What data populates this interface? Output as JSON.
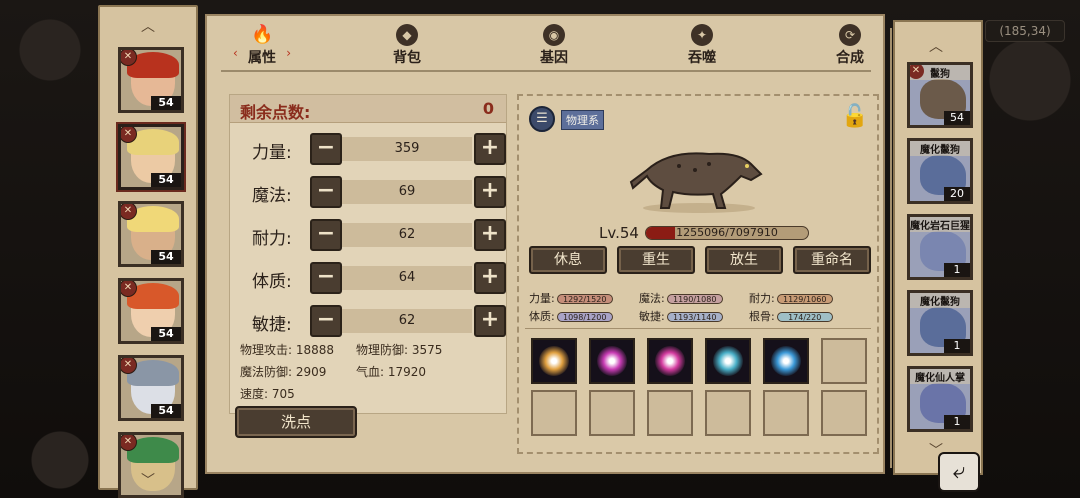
{
  "coord_text": "(185,34)",
  "roster": [
    {
      "level": "54",
      "hair": "#b8321e",
      "skin": "#e6b896"
    },
    {
      "level": "54",
      "hair": "#e8d27a",
      "skin": "#eccaa4"
    },
    {
      "level": "54",
      "hair": "#f0d878",
      "skin": "#d9b08a"
    },
    {
      "level": "54",
      "hair": "#d8582a",
      "skin": "#efcfae"
    },
    {
      "level": "54",
      "hair": "#8a96a6",
      "skin": "#dcdfe6"
    },
    {
      "level": "",
      "hair": "#3e8a4a",
      "skin": "#d8c08a"
    }
  ],
  "tabs": [
    {
      "label": "属性"
    },
    {
      "label": "背包"
    },
    {
      "label": "基因"
    },
    {
      "label": "吞噬"
    },
    {
      "label": "合成"
    }
  ],
  "stats": {
    "remaining_label": "剩余点数:",
    "remaining_value": "0",
    "rows": [
      {
        "name": "力量:",
        "value": "359"
      },
      {
        "name": "魔法:",
        "value": "69"
      },
      {
        "name": "耐力:",
        "value": "62"
      },
      {
        "name": "体质:",
        "value": "64"
      },
      {
        "name": "敏捷:",
        "value": "62"
      }
    ],
    "minus": "−",
    "plus": "+",
    "derived": {
      "phys_atk": "物理攻击: 18888",
      "phys_def": "物理防御: 3575",
      "mag_def": "魔法防御: 2909",
      "hp": "气血: 17920",
      "speed": "速度: 705"
    },
    "reset_label": "洗点"
  },
  "creature": {
    "category": "物理系",
    "level": "Lv.54",
    "hp_text": "1255096/7097910",
    "hp_fraction": 0.18,
    "actions": [
      "休息",
      "重生",
      "放生",
      "重命名"
    ],
    "stats": [
      {
        "label": "力量:",
        "value": "1292/1520",
        "color": "#c58e7a"
      },
      {
        "label": "魔法:",
        "value": "1190/1080",
        "color": "#c5a0a0"
      },
      {
        "label": "耐力:",
        "value": "1129/1060",
        "color": "#c99c76"
      },
      {
        "label": "体质:",
        "value": "1098/1200",
        "color": "#a9a3c6"
      },
      {
        "label": "敏捷:",
        "value": "1193/1140",
        "color": "#a6b0c8"
      },
      {
        "label": "根骨:",
        "value": "174/220",
        "color": "#9fbfc6"
      }
    ],
    "skills": [
      {
        "color": "#e0a040"
      },
      {
        "color": "#c83cb4"
      },
      {
        "color": "#d43ca0"
      },
      {
        "color": "#4ab0c8"
      },
      {
        "color": "#3c9ad8"
      },
      {
        "color": ""
      },
      {
        "color": ""
      },
      {
        "color": ""
      },
      {
        "color": ""
      },
      {
        "color": ""
      },
      {
        "color": ""
      },
      {
        "color": ""
      }
    ]
  },
  "pets": [
    {
      "name": "鬣狗",
      "count": "54",
      "color": "#6b5a4a"
    },
    {
      "name": "魔化鬣狗",
      "count": "20",
      "color": "#5a6d9a"
    },
    {
      "name": "魔化岩石巨猩",
      "count": "1",
      "color": "#7a86b0"
    },
    {
      "name": "魔化鬣狗",
      "count": "1",
      "color": "#5a6d9a"
    },
    {
      "name": "魔化仙人掌",
      "count": "1",
      "color": "#6a74a8"
    }
  ]
}
